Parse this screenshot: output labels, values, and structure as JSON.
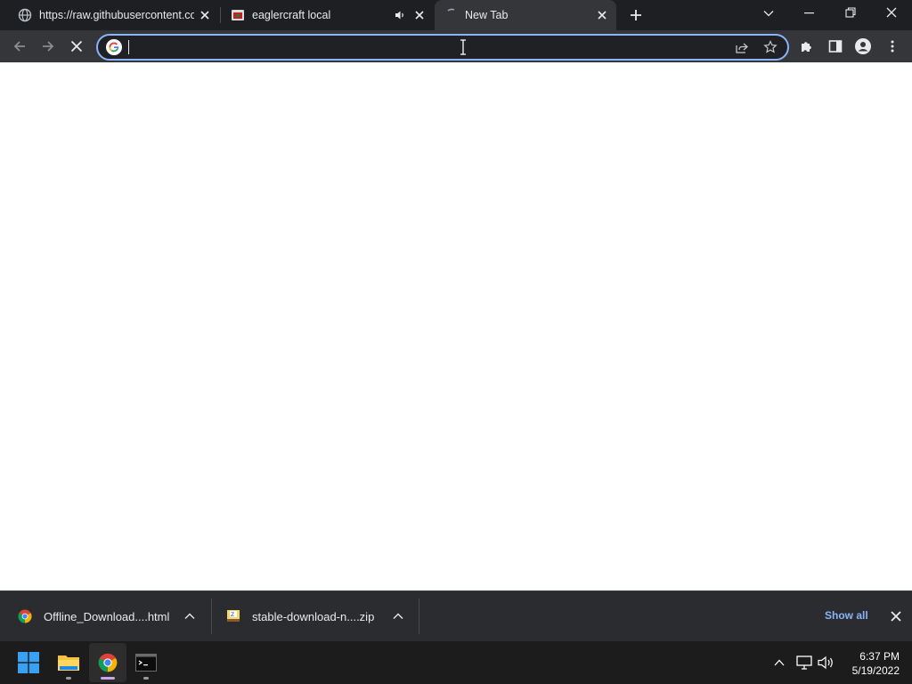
{
  "tabs": [
    {
      "title": "https://raw.githubusercontent.com",
      "icon": "globe-icon",
      "active": false
    },
    {
      "title": "eaglercraft local",
      "icon": "eaglercraft-favicon",
      "active": false,
      "audio": true
    },
    {
      "title": "New Tab",
      "icon": "loading-icon",
      "active": true
    }
  ],
  "omnibox": {
    "value": ""
  },
  "downloads": [
    {
      "filename": "Offline_Download....html",
      "icon": "chrome-icon"
    },
    {
      "filename": "stable-download-n....zip",
      "icon": "zip-file-icon"
    }
  ],
  "shelf": {
    "show_all_label": "Show all"
  },
  "taskbar": {
    "time": "6:37 PM",
    "date": "5/19/2022"
  },
  "colors": {
    "accent": "#8ab4f8",
    "tabstrip": "#1e1f22",
    "toolbar": "#35363a",
    "shelf": "#2b2c2f",
    "taskbar": "#1c1c1c"
  }
}
